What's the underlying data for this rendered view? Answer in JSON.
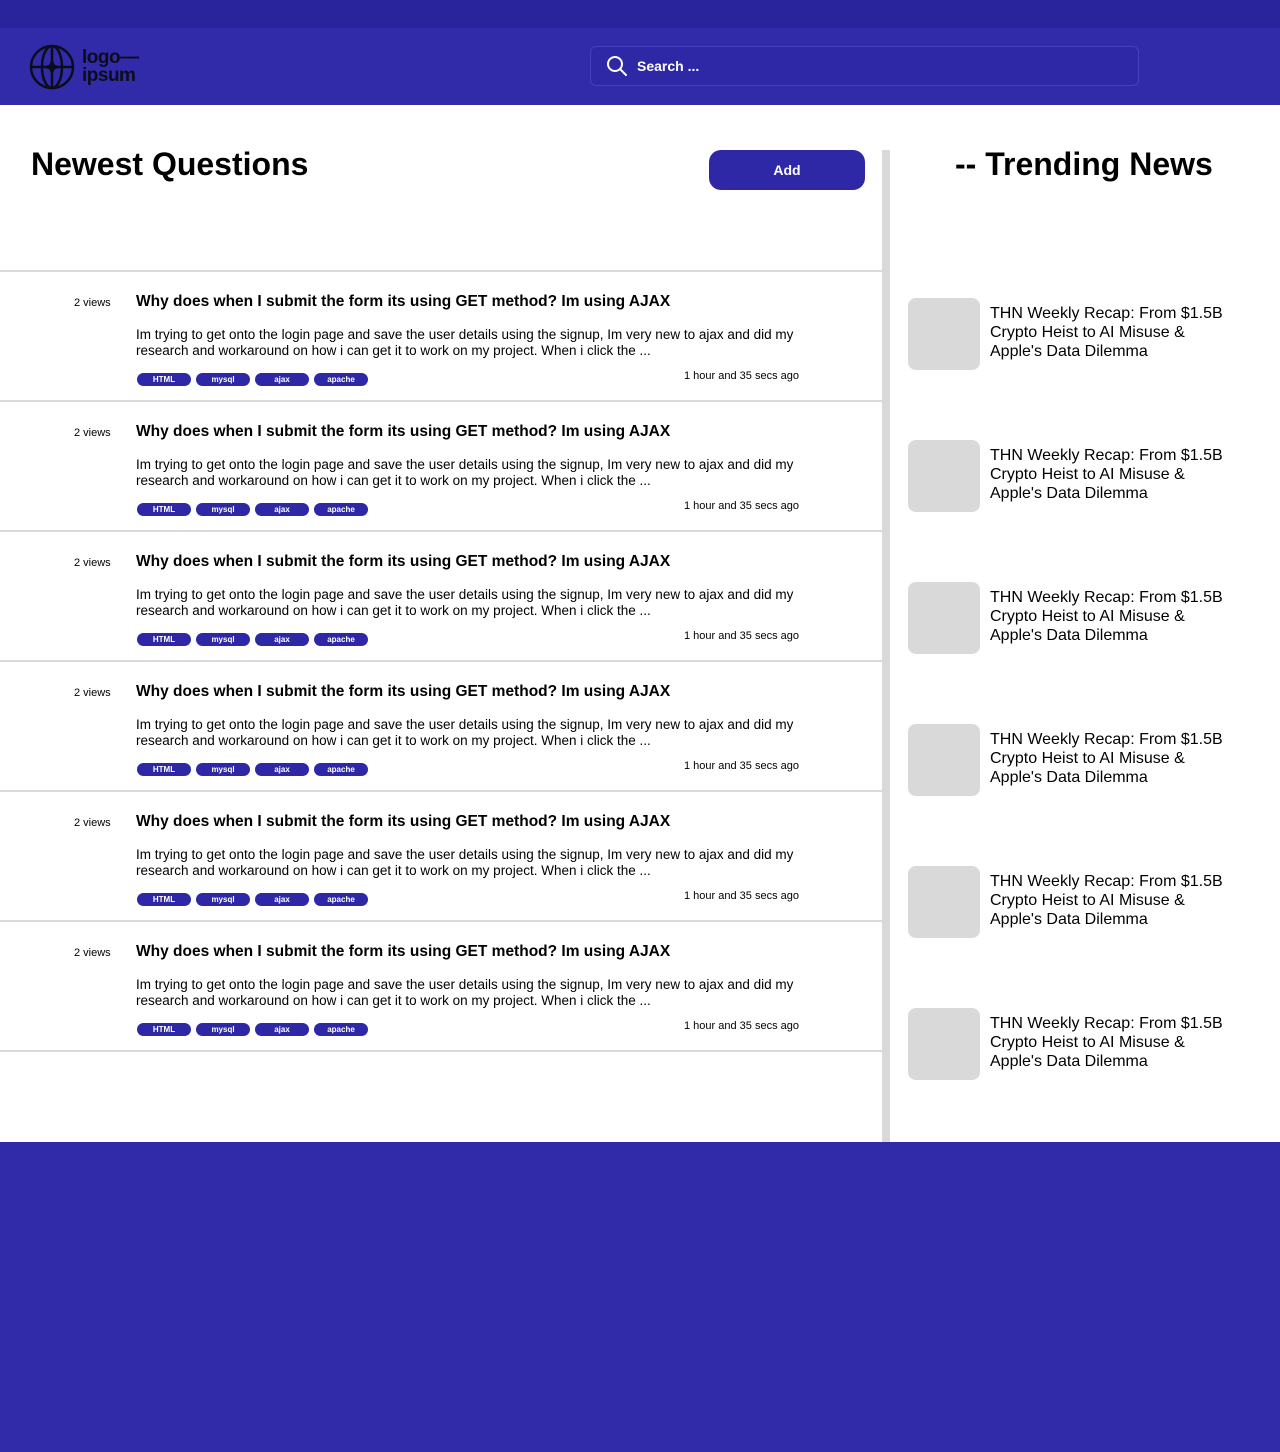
{
  "colors": {
    "topstrip": "#2a249c",
    "header": "#312aa9",
    "accent": "#2f28a6",
    "divider": "#d9d9d9"
  },
  "header": {
    "logo": {
      "line1": "logo—",
      "line2": "ipsum",
      "icon": "globe-logo-icon"
    },
    "search": {
      "placeholder": "Search ...",
      "icon": "search-icon"
    }
  },
  "main": {
    "title": "Newest Questions",
    "add_label": "Add",
    "questions": [
      {
        "views": "2 views",
        "title": "Why does when I submit the form its using GET method? Im using AJAX",
        "body": "Im trying to get onto the login page and save the user details using the signup, Im very new to ajax and did my research and workaround on how i can get it to work on my project. When i click the ...",
        "tags": [
          "HTML",
          "mysql",
          "ajax",
          "apache"
        ],
        "time": "1 hour and 35 secs ago"
      },
      {
        "views": "2 views",
        "title": "Why does when I submit the form its using GET method? Im using AJAX",
        "body": "Im trying to get onto the login page and save the user details using the signup, Im very new to ajax and did my research and workaround on how i can get it to work on my project. When i click the ...",
        "tags": [
          "HTML",
          "mysql",
          "ajax",
          "apache"
        ],
        "time": "1 hour and 35 secs ago"
      },
      {
        "views": "2 views",
        "title": "Why does when I submit the form its using GET method? Im using AJAX",
        "body": "Im trying to get onto the login page and save the user details using the signup, Im very new to ajax and did my research and workaround on how i can get it to work on my project. When i click the ...",
        "tags": [
          "HTML",
          "mysql",
          "ajax",
          "apache"
        ],
        "time": "1 hour and 35 secs ago"
      },
      {
        "views": "2 views",
        "title": "Why does when I submit the form its using GET method? Im using AJAX",
        "body": "Im trying to get onto the login page and save the user details using the signup, Im very new to ajax and did my research and workaround on how i can get it to work on my project. When i click the ...",
        "tags": [
          "HTML",
          "mysql",
          "ajax",
          "apache"
        ],
        "time": "1 hour and 35 secs ago"
      },
      {
        "views": "2 views",
        "title": "Why does when I submit the form its using GET method? Im using AJAX",
        "body": "Im trying to get onto the login page and save the user details using the signup, Im very new to ajax and did my research and workaround on how i can get it to work on my project. When i click the ...",
        "tags": [
          "HTML",
          "mysql",
          "ajax",
          "apache"
        ],
        "time": "1 hour and 35 secs ago"
      },
      {
        "views": "2 views",
        "title": "Why does when I submit the form its using GET method? Im using AJAX",
        "body": "Im trying to get onto the login page and save the user details using the signup, Im very new to ajax and did my research and workaround on how i can get it to work on my project. When i click the ...",
        "tags": [
          "HTML",
          "mysql",
          "ajax",
          "apache"
        ],
        "time": "1 hour and 35 secs ago"
      }
    ]
  },
  "sidebar": {
    "title": "-- Trending News",
    "news": [
      {
        "text": "THN Weekly Recap: From $1.5B Crypto Heist to AI Misuse & Apple's Data Dilemma"
      },
      {
        "text": "THN Weekly Recap: From $1.5B Crypto Heist to AI Misuse & Apple's Data Dilemma"
      },
      {
        "text": "THN Weekly Recap: From $1.5B Crypto Heist to AI Misuse & Apple's Data Dilemma"
      },
      {
        "text": "THN Weekly Recap: From $1.5B Crypto Heist to AI Misuse & Apple's Data Dilemma"
      },
      {
        "text": "THN Weekly Recap: From $1.5B Crypto Heist to AI Misuse & Apple's Data Dilemma"
      },
      {
        "text": "THN Weekly Recap: From $1.5B Crypto Heist to AI Misuse & Apple's Data Dilemma"
      }
    ]
  }
}
